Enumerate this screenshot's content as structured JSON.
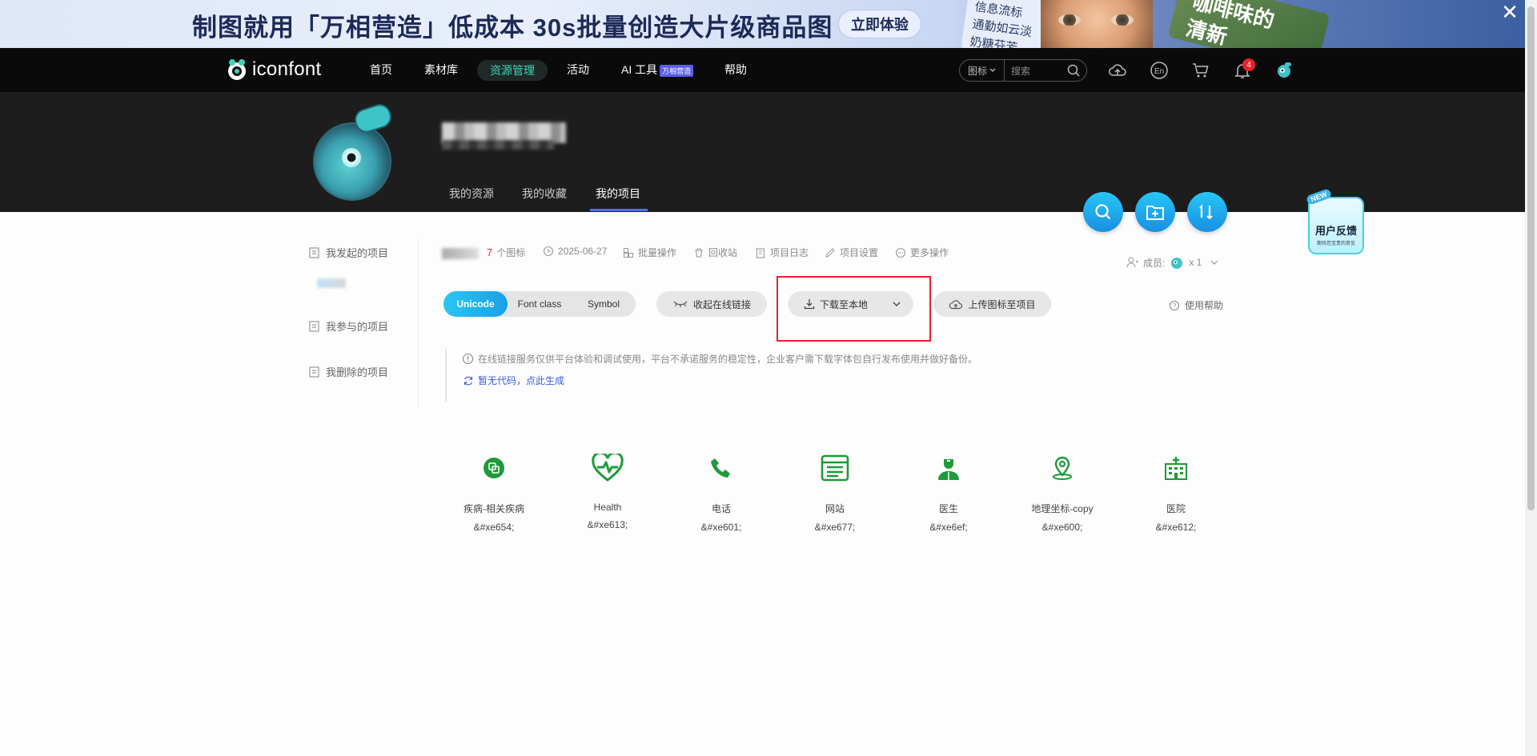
{
  "banner": {
    "title": "制图就用「万相营造」低成本 30s批量创造大片级商品图",
    "cta": "立即体验",
    "card_lines": [
      "信息流标",
      "通勤如云淡",
      "奶糖芬芳"
    ],
    "card2_lines": [
      "咖啡味的",
      "清新"
    ],
    "close": "✕"
  },
  "nav": {
    "logo": "iconfont",
    "items": [
      "首页",
      "素材库",
      "资源管理",
      "活动",
      "AI 工具",
      "帮助"
    ],
    "ai_badge": "万相营造",
    "search_select": "图标",
    "search_placeholder": "搜索",
    "notify_count": "4"
  },
  "profile": {
    "tabs": [
      "我的资源",
      "我的收藏",
      "我的项目"
    ]
  },
  "feedback": {
    "badge": "NEW",
    "title": "用户反馈",
    "sub": "期待您宝贵的意见"
  },
  "sidebar": {
    "items": [
      "我发起的项目",
      "我参与的项目",
      "我删除的项目"
    ]
  },
  "meta": {
    "count": "7",
    "count_label": "个图标",
    "date": "2025-06-27",
    "actions": [
      "批量操作",
      "回收站",
      "项目日志",
      "项目设置",
      "更多操作"
    ],
    "members_label": "成员:",
    "members_count": "x 1"
  },
  "toolbar": {
    "modes": [
      "Unicode",
      "Font class",
      "Symbol"
    ],
    "collapse": "收起在线链接",
    "download": "下载至本地",
    "upload": "上传图标至项目",
    "help": "使用帮助"
  },
  "notice": {
    "text": "在线链接服务仅供平台体验和调试使用，平台不承诺服务的稳定性，企业客户需下载字体包自行发布使用并做好备份。",
    "link": "暂无代码，点此生成"
  },
  "icons": [
    {
      "name": "疾病-相关疾病",
      "code": "&#xe654;",
      "glyph": "disease-icon"
    },
    {
      "name": "Health",
      "code": "&#xe613;",
      "glyph": "heart-pulse-icon"
    },
    {
      "name": "电话",
      "code": "&#xe601;",
      "glyph": "phone-icon"
    },
    {
      "name": "网站",
      "code": "&#xe677;",
      "glyph": "website-icon"
    },
    {
      "name": "医生",
      "code": "&#xe6ef;",
      "glyph": "doctor-icon"
    },
    {
      "name": "地理坐标-copy",
      "code": "&#xe600;",
      "glyph": "location-icon"
    },
    {
      "name": "医院",
      "code": "&#xe612;",
      "glyph": "hospital-icon"
    }
  ],
  "colors": {
    "accent": "#1aa0e6",
    "icon_green": "#1f9a3a",
    "alert_red": "#e8222b",
    "link_blue": "#3b5bdb"
  }
}
